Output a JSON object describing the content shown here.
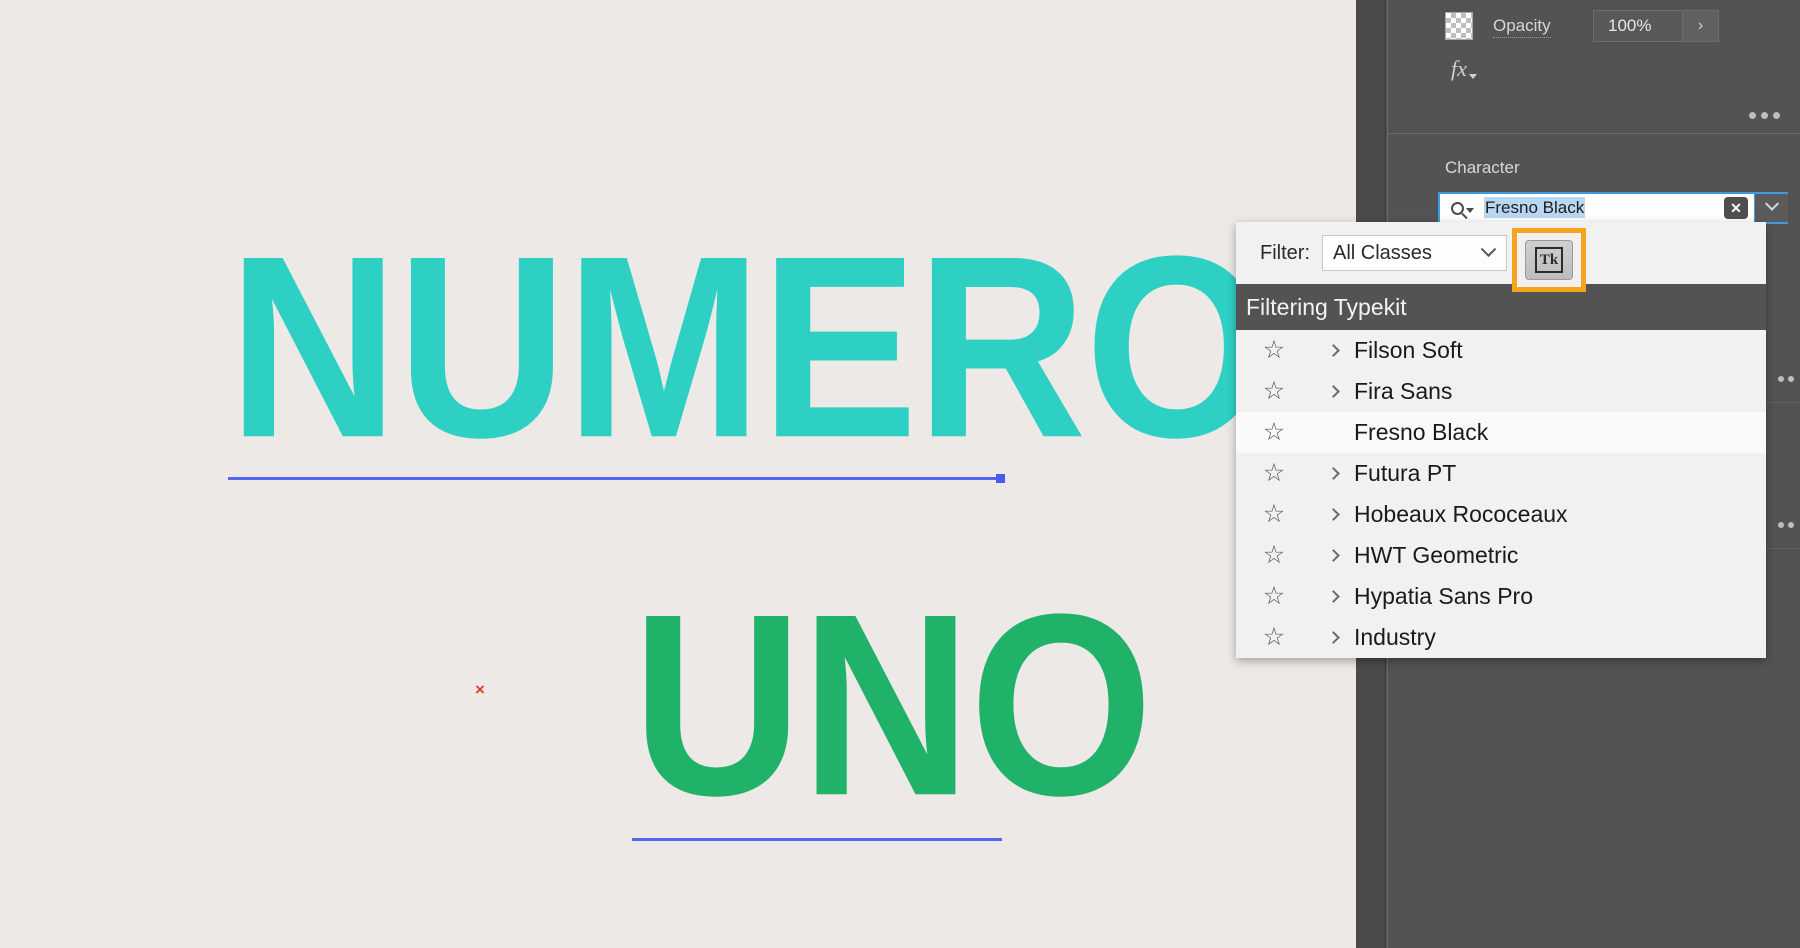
{
  "canvas": {
    "background_color": "#EDE9E6",
    "artwork": [
      {
        "text": "NUMERO",
        "color": "#2ED0C4"
      },
      {
        "text": "UNO",
        "color": "#1FB268"
      }
    ],
    "cursor_marker": "×",
    "baseline_color": "#5566F0"
  },
  "panel": {
    "opacity": {
      "label": "Opacity",
      "value": "100%",
      "stepper_glyph": "›"
    },
    "fx_label": "fx",
    "character_label": "Character",
    "search": {
      "value": "Fresno Black",
      "clear_glyph": "✕",
      "accent_color": "#3E9BE0"
    }
  },
  "popup": {
    "filter_label": "Filter:",
    "filter_value": "All Classes",
    "filter_options": [
      "All Classes"
    ],
    "toolbar": {
      "typekit_label": "Tk",
      "typekit_highlight_color": "#F6A31E",
      "star_glyph": "★",
      "wave_glyph": "≈"
    },
    "header": "Filtering Typekit",
    "fonts": [
      {
        "name": "Filson Soft",
        "expandable": true,
        "selected": false,
        "favorite": false
      },
      {
        "name": "Fira Sans",
        "expandable": true,
        "selected": false,
        "favorite": false
      },
      {
        "name": "Fresno Black",
        "expandable": false,
        "selected": true,
        "favorite": false
      },
      {
        "name": "Futura PT",
        "expandable": true,
        "selected": false,
        "favorite": false
      },
      {
        "name": "Hobeaux Rococeaux",
        "expandable": true,
        "selected": false,
        "favorite": false
      },
      {
        "name": "HWT Geometric",
        "expandable": true,
        "selected": false,
        "favorite": false
      },
      {
        "name": "Hypatia Sans Pro",
        "expandable": true,
        "selected": false,
        "favorite": false
      },
      {
        "name": "Industry",
        "expandable": true,
        "selected": false,
        "favorite": false
      }
    ],
    "star_outline_glyph": "☆"
  }
}
